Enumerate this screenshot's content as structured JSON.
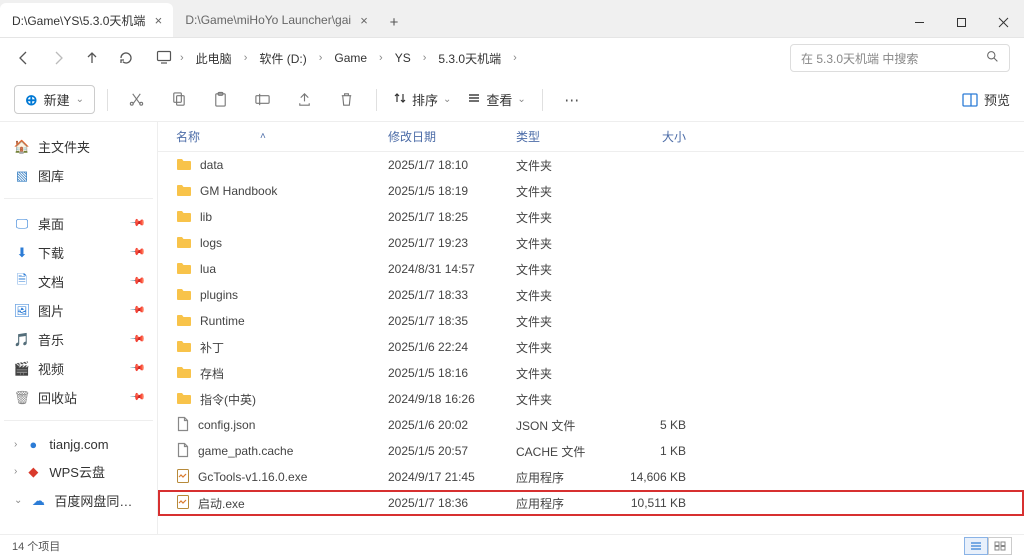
{
  "tabs": [
    {
      "title": "D:\\Game\\YS\\5.3.0天机端",
      "active": true
    },
    {
      "title": "D:\\Game\\miHoYo Launcher\\gai",
      "active": false
    }
  ],
  "breadcrumbs": [
    "此电脑",
    "软件 (D:)",
    "Game",
    "YS",
    "5.3.0天机端"
  ],
  "search_placeholder": "在 5.3.0天机端 中搜索",
  "toolbar": {
    "new_label": "新建",
    "sort_label": "排序",
    "view_label": "查看",
    "preview_label": "预览"
  },
  "columns": {
    "name": "名称",
    "date": "修改日期",
    "type": "类型",
    "size": "大小"
  },
  "sidebar": {
    "home": "主文件夹",
    "gallery": "图库",
    "desktop": "桌面",
    "downloads": "下载",
    "documents": "文档",
    "pictures": "图片",
    "music": "音乐",
    "videos": "视频",
    "recycle": "回收站",
    "tianjg": "tianjg.com",
    "wps": "WPS云盘",
    "baidu": "百度网盘同步空"
  },
  "files": [
    {
      "name": "data",
      "date": "2025/1/7 18:10",
      "type": "文件夹",
      "size": "",
      "icon": "folder"
    },
    {
      "name": "GM Handbook",
      "date": "2025/1/5 18:19",
      "type": "文件夹",
      "size": "",
      "icon": "folder"
    },
    {
      "name": "lib",
      "date": "2025/1/7 18:25",
      "type": "文件夹",
      "size": "",
      "icon": "folder"
    },
    {
      "name": "logs",
      "date": "2025/1/7 19:23",
      "type": "文件夹",
      "size": "",
      "icon": "folder"
    },
    {
      "name": "lua",
      "date": "2024/8/31 14:57",
      "type": "文件夹",
      "size": "",
      "icon": "folder"
    },
    {
      "name": "plugins",
      "date": "2025/1/7 18:33",
      "type": "文件夹",
      "size": "",
      "icon": "folder"
    },
    {
      "name": "Runtime",
      "date": "2025/1/7 18:35",
      "type": "文件夹",
      "size": "",
      "icon": "folder"
    },
    {
      "name": "补丁",
      "date": "2025/1/6 22:24",
      "type": "文件夹",
      "size": "",
      "icon": "folder"
    },
    {
      "name": "存档",
      "date": "2025/1/5 18:16",
      "type": "文件夹",
      "size": "",
      "icon": "folder"
    },
    {
      "name": "指令(中英)",
      "date": "2024/9/18 16:26",
      "type": "文件夹",
      "size": "",
      "icon": "folder"
    },
    {
      "name": "config.json",
      "date": "2025/1/6 20:02",
      "type": "JSON 文件",
      "size": "5 KB",
      "icon": "file"
    },
    {
      "name": "game_path.cache",
      "date": "2025/1/5 20:57",
      "type": "CACHE 文件",
      "size": "1 KB",
      "icon": "file"
    },
    {
      "name": "GcTools-v1.16.0.exe",
      "date": "2024/9/17 21:45",
      "type": "应用程序",
      "size": "14,606 KB",
      "icon": "exe"
    },
    {
      "name": "启动.exe",
      "date": "2025/1/7 18:36",
      "type": "应用程序",
      "size": "10,511 KB",
      "icon": "exe",
      "highlight": true
    }
  ],
  "status": "14 个项目"
}
